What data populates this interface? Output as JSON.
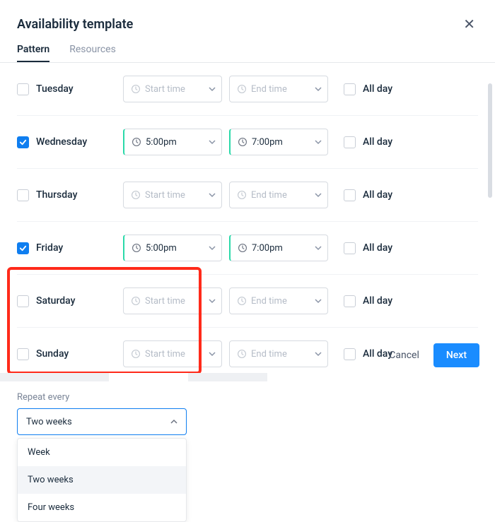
{
  "header": {
    "title": "Availability template"
  },
  "tabs": [
    {
      "label": "Pattern",
      "active": true
    },
    {
      "label": "Resources",
      "active": false
    }
  ],
  "placeholders": {
    "start": "Start time",
    "end": "End time"
  },
  "allday_label": "All day",
  "days": [
    {
      "name": "Tuesday",
      "checked": false,
      "start": "",
      "end": "",
      "allday": false
    },
    {
      "name": "Wednesday",
      "checked": true,
      "start": "5:00pm",
      "end": "7:00pm",
      "allday": false
    },
    {
      "name": "Thursday",
      "checked": false,
      "start": "",
      "end": "",
      "allday": false
    },
    {
      "name": "Friday",
      "checked": true,
      "start": "5:00pm",
      "end": "7:00pm",
      "allday": false
    },
    {
      "name": "Saturday",
      "checked": false,
      "start": "",
      "end": "",
      "allday": false
    },
    {
      "name": "Sunday",
      "checked": false,
      "start": "",
      "end": "",
      "allday": false
    }
  ],
  "repeat": {
    "label": "Repeat every",
    "selected": "Two weeks",
    "options": [
      "Week",
      "Two weeks",
      "Four weeks"
    ]
  },
  "footer": {
    "cancel": "Cancel",
    "next": "Next"
  }
}
